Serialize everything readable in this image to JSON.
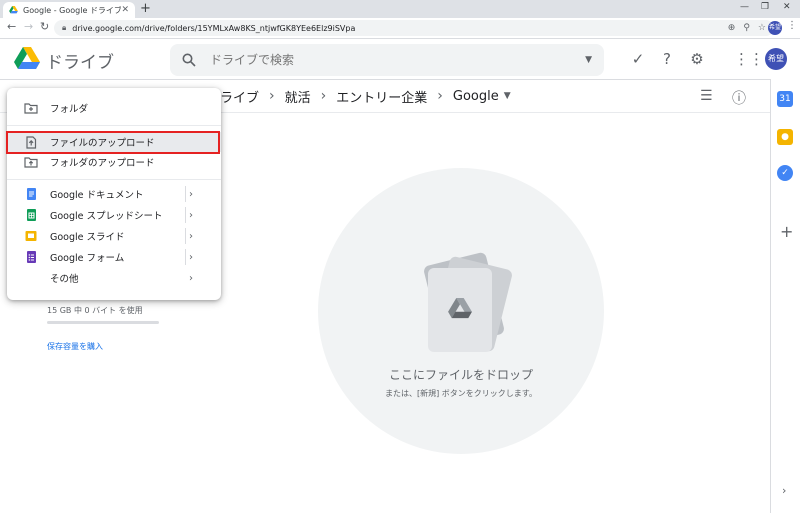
{
  "browser": {
    "tab_title": "Google - Google ドライブ",
    "url": "drive.google.com/drive/folders/15YMLxAw8KS_ntjwfGK8YEe6Elz9iSVpa",
    "avatar_label": "希望"
  },
  "header": {
    "product_name": "ドライブ",
    "search_placeholder": "ドライブで検索",
    "avatar_label": "希望"
  },
  "breadcrumb": {
    "items": [
      "ライブ",
      "就活",
      "エントリー企業",
      "Google"
    ]
  },
  "new_menu": {
    "items": [
      {
        "label": "フォルダ",
        "icon": "folder-plus-icon"
      },
      {
        "label": "ファイルのアップロード",
        "icon": "file-upload-icon"
      },
      {
        "label": "フォルダのアップロード",
        "icon": "folder-upload-icon"
      },
      {
        "label": "Google ドキュメント",
        "icon": "google-docs-icon",
        "color": "#4285f4"
      },
      {
        "label": "Google スプレッドシート",
        "icon": "google-sheets-icon",
        "color": "#0f9d58"
      },
      {
        "label": "Google スライド",
        "icon": "google-slides-icon",
        "color": "#f4b400"
      },
      {
        "label": "Google フォーム",
        "icon": "google-forms-icon",
        "color": "#673ab7"
      },
      {
        "label": "その他",
        "icon": ""
      }
    ],
    "highlighted_item": "ファイルのアップロード"
  },
  "storage": {
    "usage_text": "15 GB 中 0 バイト を使用",
    "usage_fraction": 0,
    "buy_label": "保存容量を購入"
  },
  "dropzone": {
    "title": "ここにファイルをドロップ",
    "subtitle": "または、[新規] ボタンをクリックします。"
  },
  "side_panel": {
    "calendar_label": "31"
  },
  "colors": {
    "accent_blue": "#1a73e8",
    "highlight_red": "#e52222",
    "avatar": "#3f51b5"
  }
}
